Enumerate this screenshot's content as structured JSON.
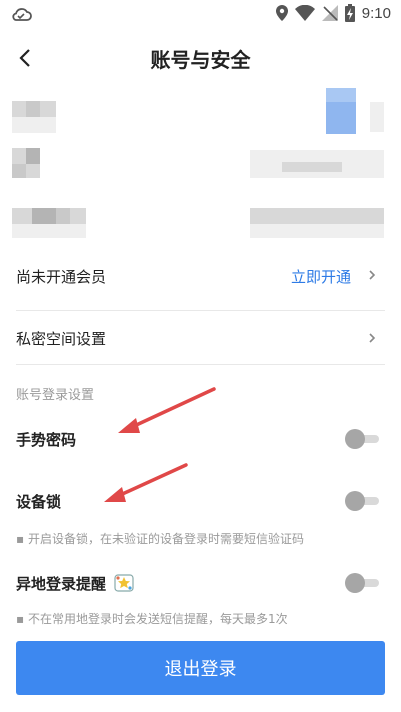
{
  "status_bar": {
    "time": "9:10",
    "icons": [
      "cloud-icon",
      "location-icon",
      "wifi-icon",
      "signal-off-icon",
      "battery-charging-icon"
    ]
  },
  "header": {
    "title": "账号与安全",
    "back_icon": "chevron-left-icon"
  },
  "rows": {
    "vip": {
      "label": "尚未开通会员",
      "action": "立即开通"
    },
    "private_space": {
      "label": "私密空间设置"
    }
  },
  "login_settings": {
    "section_title": "账号登录设置",
    "gesture_password": {
      "label": "手势密码",
      "enabled": false
    },
    "device_lock": {
      "label": "设备锁",
      "enabled": false,
      "hint": "开启设备锁，在未验证的设备登录时需要短信验证码"
    },
    "remote_login_alert": {
      "label": "异地登录提醒",
      "badge_icon": "star-badge-icon",
      "enabled": false,
      "hint": "不在常用地登录时会发送短信提醒，每天最多1次"
    }
  },
  "logout_button": "退出登录",
  "colors": {
    "accent": "#3d88f0",
    "link": "#2e7be6",
    "annotation_arrow": "#e04848",
    "toggle_off_knob": "#a6a6a6"
  }
}
